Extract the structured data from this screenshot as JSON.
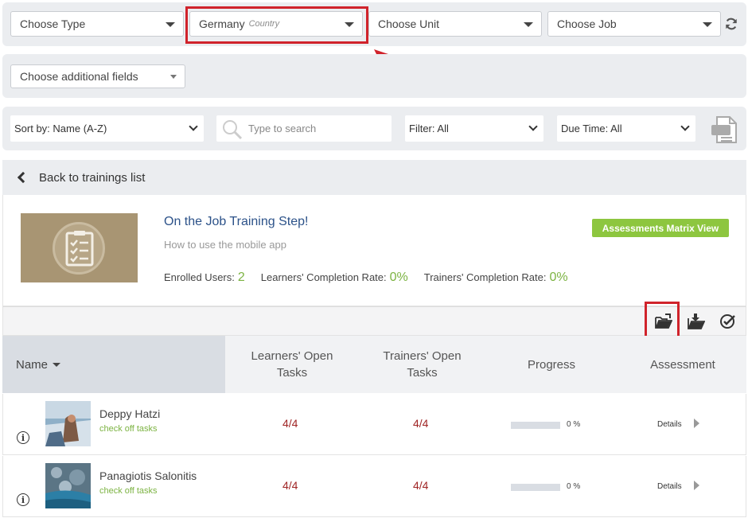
{
  "filters": {
    "type_label": "Choose Type",
    "country_value": "Germany",
    "country_hint": "Country",
    "unit_label": "Choose Unit",
    "job_label": "Choose Job",
    "additional_label": "Choose additional fields"
  },
  "toolbar_row": {
    "sort_label": "Sort by: Name (A-Z)",
    "search_placeholder": "Type to search",
    "filter_label": "Filter: All",
    "due_label": "Due Time: All"
  },
  "back_label": "Back to trainings list",
  "training": {
    "title": "On the Job Training Step!",
    "subtitle": "How to use the mobile app",
    "enrolled_label": "Enrolled Users:",
    "enrolled_value": "2",
    "learners_rate_label": "Learners' Completion Rate:",
    "learners_rate_value": "0%",
    "trainers_rate_label": "Trainers' Completion Rate:",
    "trainers_rate_value": "0%",
    "matrix_button": "Assessments Matrix View"
  },
  "table": {
    "headers": {
      "name": "Name",
      "learners_open": "Learners' Open Tasks",
      "trainers_open": "Trainers' Open Tasks",
      "progress": "Progress",
      "assessment": "Assessment"
    },
    "rows": [
      {
        "name": "Deppy Hatzi",
        "action": "check off tasks",
        "learners_open": "4/4",
        "trainers_open": "4/4",
        "progress": 0,
        "progress_label": "0 %",
        "details": "Details"
      },
      {
        "name": "Panagiotis Salonitis",
        "action": "check off tasks",
        "learners_open": "4/4",
        "trainers_open": "4/4",
        "progress": 0,
        "progress_label": "0 %",
        "details": "Details"
      }
    ]
  },
  "colors": {
    "accent_green": "#8dc63f",
    "title_blue": "#2c5289",
    "task_red": "#a02626",
    "highlight_red": "#d0232b"
  }
}
